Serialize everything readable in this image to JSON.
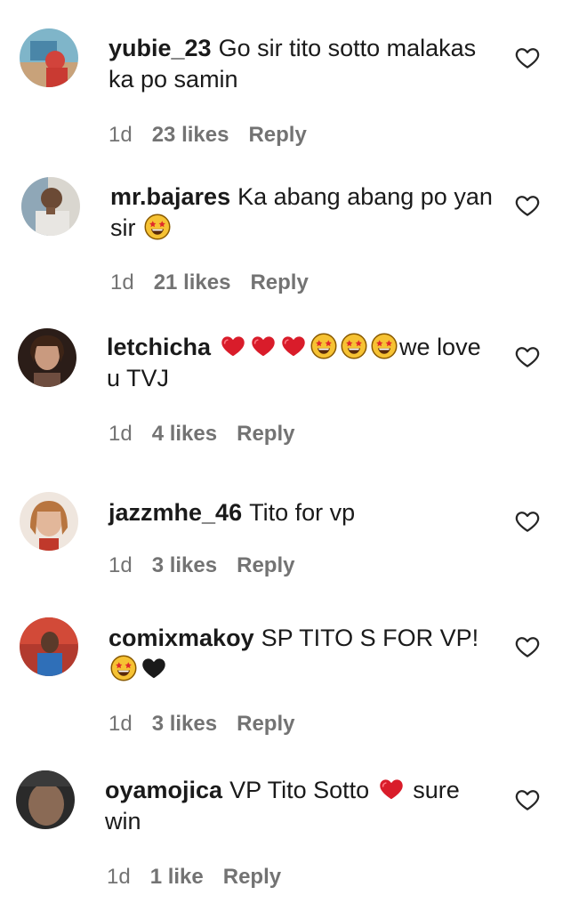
{
  "comments": [
    {
      "username": "yubie_23",
      "text_parts": [
        "Go sir tito sotto malakas ka po samin"
      ],
      "time": "1d",
      "likes": "23 likes",
      "reply": "Reply"
    },
    {
      "username": "mr.bajares",
      "text_parts": [
        "Ka abang abang po yan sir"
      ],
      "emojis": [
        "star-struck"
      ],
      "time": "1d",
      "likes": "21 likes",
      "reply": "Reply"
    },
    {
      "username": "letchicha",
      "text_parts": [
        "we love u TVJ"
      ],
      "emojis": [
        "red-heart",
        "red-heart",
        "red-heart",
        "star-struck",
        "star-struck",
        "star-struck"
      ],
      "time": "1d",
      "likes": "4 likes",
      "reply": "Reply"
    },
    {
      "username": "jazzmhe_46",
      "text_parts": [
        "Tito for vp"
      ],
      "time": "1d",
      "likes": "3 likes",
      "reply": "Reply"
    },
    {
      "username": "comixmakoy",
      "text_parts": [
        "SP TITO S FOR VP!"
      ],
      "emojis": [
        "star-struck",
        "black-heart"
      ],
      "time": "1d",
      "likes": "3 likes",
      "reply": "Reply"
    },
    {
      "username": "oyamojica",
      "text_parts": [
        "VP Tito Sotto",
        "sure win"
      ],
      "emojis": [
        "red-heart"
      ],
      "time": "1d",
      "likes": "1 like",
      "reply": "Reply"
    }
  ],
  "icons": {
    "like": "heart-outline-icon"
  },
  "colors": {
    "text": "#262626",
    "meta": "#737373",
    "heart": "#e0245e"
  }
}
